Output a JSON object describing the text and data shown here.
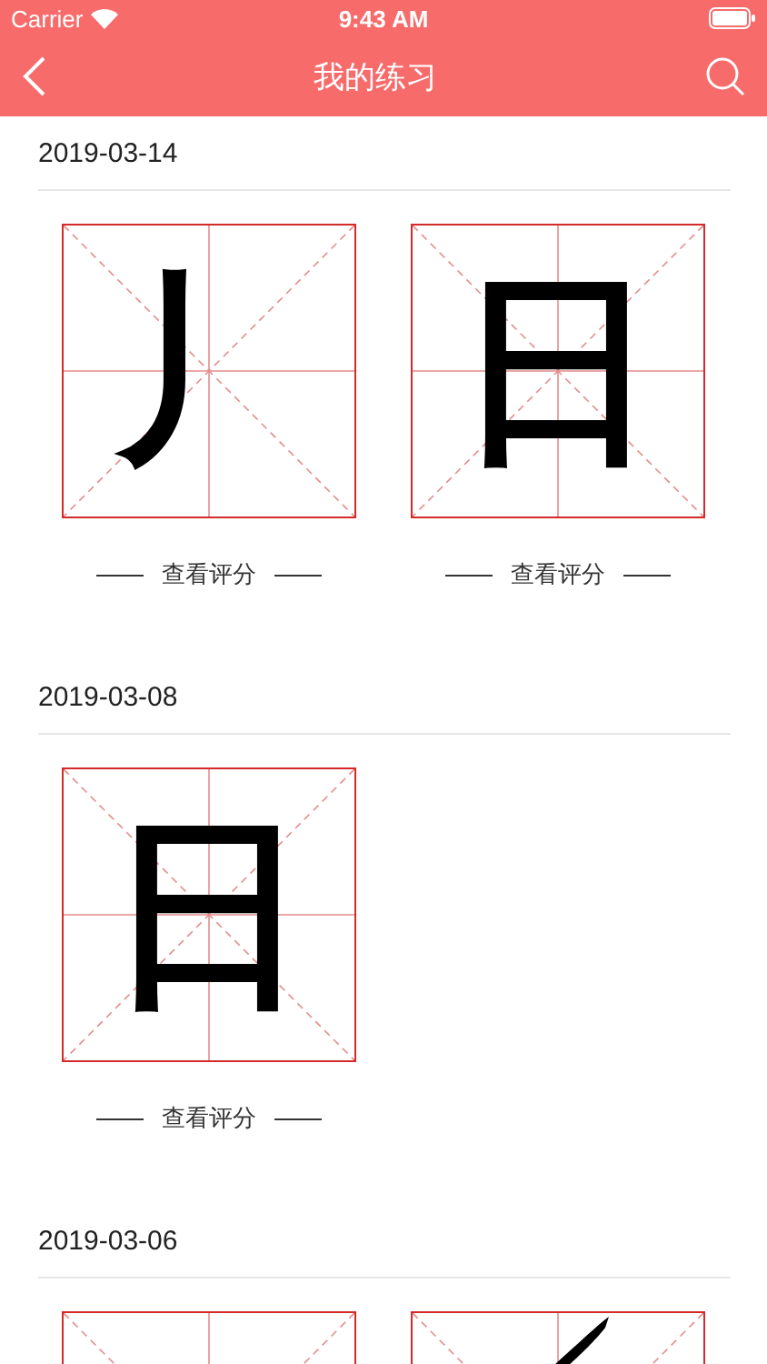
{
  "status_bar": {
    "carrier": "Carrier",
    "time": "9:43 AM"
  },
  "header": {
    "title": "我的练习"
  },
  "sections": [
    {
      "date": "2019-03-14",
      "cards": [
        {
          "kind": "character",
          "character": "丿",
          "action": "查看评分"
        },
        {
          "kind": "character",
          "character": "日",
          "action": "查看评分"
        }
      ]
    },
    {
      "date": "2019-03-08",
      "cards": [
        {
          "kind": "character",
          "character": "日",
          "action": "查看评分"
        }
      ]
    },
    {
      "date": "2019-03-06",
      "cards": [
        {
          "kind": "blank"
        },
        {
          "kind": "stroke"
        }
      ]
    }
  ]
}
